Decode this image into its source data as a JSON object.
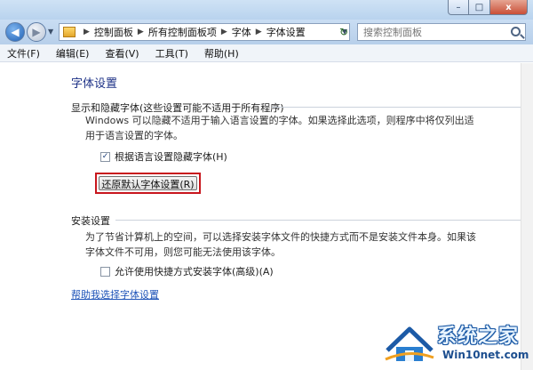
{
  "window": {
    "caption_buttons": {
      "minimize": "–",
      "maximize": "□",
      "close": "x"
    }
  },
  "nav": {
    "back_icon": "back-arrow-icon",
    "forward_icon": "forward-arrow-icon",
    "address": {
      "breadcrumbs": [
        "控制面板",
        "所有控制面板项",
        "字体",
        "字体设置"
      ]
    },
    "search": {
      "placeholder": "搜索控制面板"
    }
  },
  "menu": {
    "items": [
      "文件(F)",
      "编辑(E)",
      "查看(V)",
      "工具(T)",
      "帮助(H)"
    ]
  },
  "main": {
    "title": "字体设置",
    "section_hide": {
      "heading": "显示和隐藏字体(这些设置可能不适用于所有程序)",
      "description": "Windows 可以隐藏不适用于输入语言设置的字体。如果选择此选项，则程序中将仅列出适用于语言设置的字体。",
      "checkbox_label": "根据语言设置隐藏字体(H)",
      "checkbox_checked": true,
      "restore_button": "还原默认字体设置(R)"
    },
    "section_install": {
      "heading": "安装设置",
      "description": "为了节省计算机上的空间，可以选择安装字体文件的快捷方式而不是安装文件本身。如果该字体文件不可用，则您可能无法使用该字体。",
      "checkbox_label": "允许使用快捷方式安装字体(高级)(A)",
      "checkbox_checked": false
    },
    "help_link": "帮助我选择字体设置"
  },
  "watermark": {
    "title": "系统之家",
    "url": "Win10net.com"
  },
  "colors": {
    "title_blue": "#1e3287",
    "link_blue": "#1e53b8",
    "highlight_red": "#c8161d"
  }
}
